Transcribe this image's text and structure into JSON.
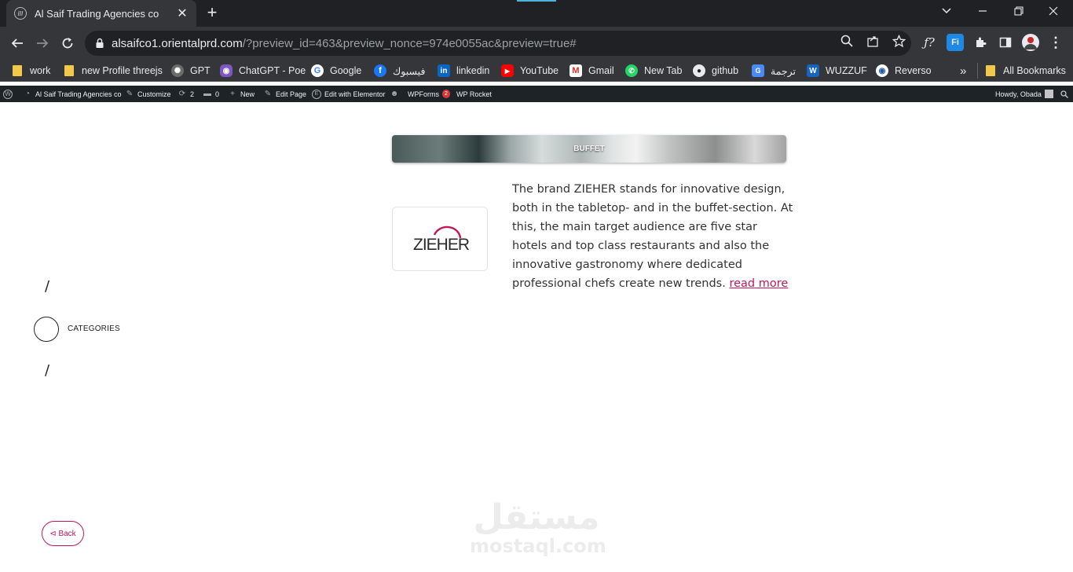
{
  "browser": {
    "tab_title": "Al Saif Trading Agencies co",
    "url_host": "alsaifco1.orientalprd.com",
    "url_rest": "/?preview_id=463&preview_nonce=974e0055ac&preview=true#",
    "window_controls": [
      "chevron-down-icon",
      "minimize-icon",
      "restore-icon",
      "close-icon"
    ]
  },
  "bookmarks": {
    "items": [
      {
        "label": "work",
        "icon": "folder"
      },
      {
        "label": "new Profile threejs",
        "icon": "folder"
      },
      {
        "label": "GPT",
        "icon": "gpt"
      },
      {
        "label": "ChatGPT - Poe",
        "icon": "poe"
      },
      {
        "label": "Google",
        "icon": "google"
      },
      {
        "label": "فيسبوك",
        "icon": "facebook"
      },
      {
        "label": "linkedin",
        "icon": "linkedin"
      },
      {
        "label": "YouTube",
        "icon": "youtube"
      },
      {
        "label": "Gmail",
        "icon": "gmail"
      },
      {
        "label": "New Tab",
        "icon": "whatsapp"
      },
      {
        "label": "github",
        "icon": "github"
      },
      {
        "label": "ترجمة",
        "icon": "translate"
      },
      {
        "label": "WUZZUF",
        "icon": "wuzzuf"
      },
      {
        "label": "Reverso",
        "icon": "reverso"
      }
    ],
    "overflow": "»",
    "all_bookmarks": "All Bookmarks"
  },
  "wpbar": {
    "site_name": "Al Saif Trading Agencies co",
    "customize": "Customize",
    "updates": "2",
    "comments": "0",
    "new": "New",
    "edit_page": "Edit Page",
    "elementor": "Edit with Elementor",
    "wpforms": "WPForms",
    "wpforms_badge": "2",
    "wprocket": "WP Rocket",
    "howdy": "Howdy, Obada"
  },
  "sidebar": {
    "slash_top": "/",
    "categories_label": "CATEGORIES",
    "slash_bottom": "/"
  },
  "main": {
    "banner_title": "BUFFET",
    "brand_logo_text": "ZIEHER",
    "description": "The brand ZIEHER stands for innovative design, both in the tabletop- and in the buffet-section. At this, the main target audience are five star hotels and top class restaurants and also the innovative gastronomy where dedicated professional chefs create new trends.",
    "read_more": "read more"
  },
  "watermark": {
    "arabic": "مستقل",
    "latin": "mostaql.com"
  },
  "back_button": "⊲ Back",
  "colors": {
    "accent": "#c2185b",
    "chrome_dark": "#202124",
    "chrome_mid": "#35363a",
    "wp_bar": "#1d2327"
  }
}
